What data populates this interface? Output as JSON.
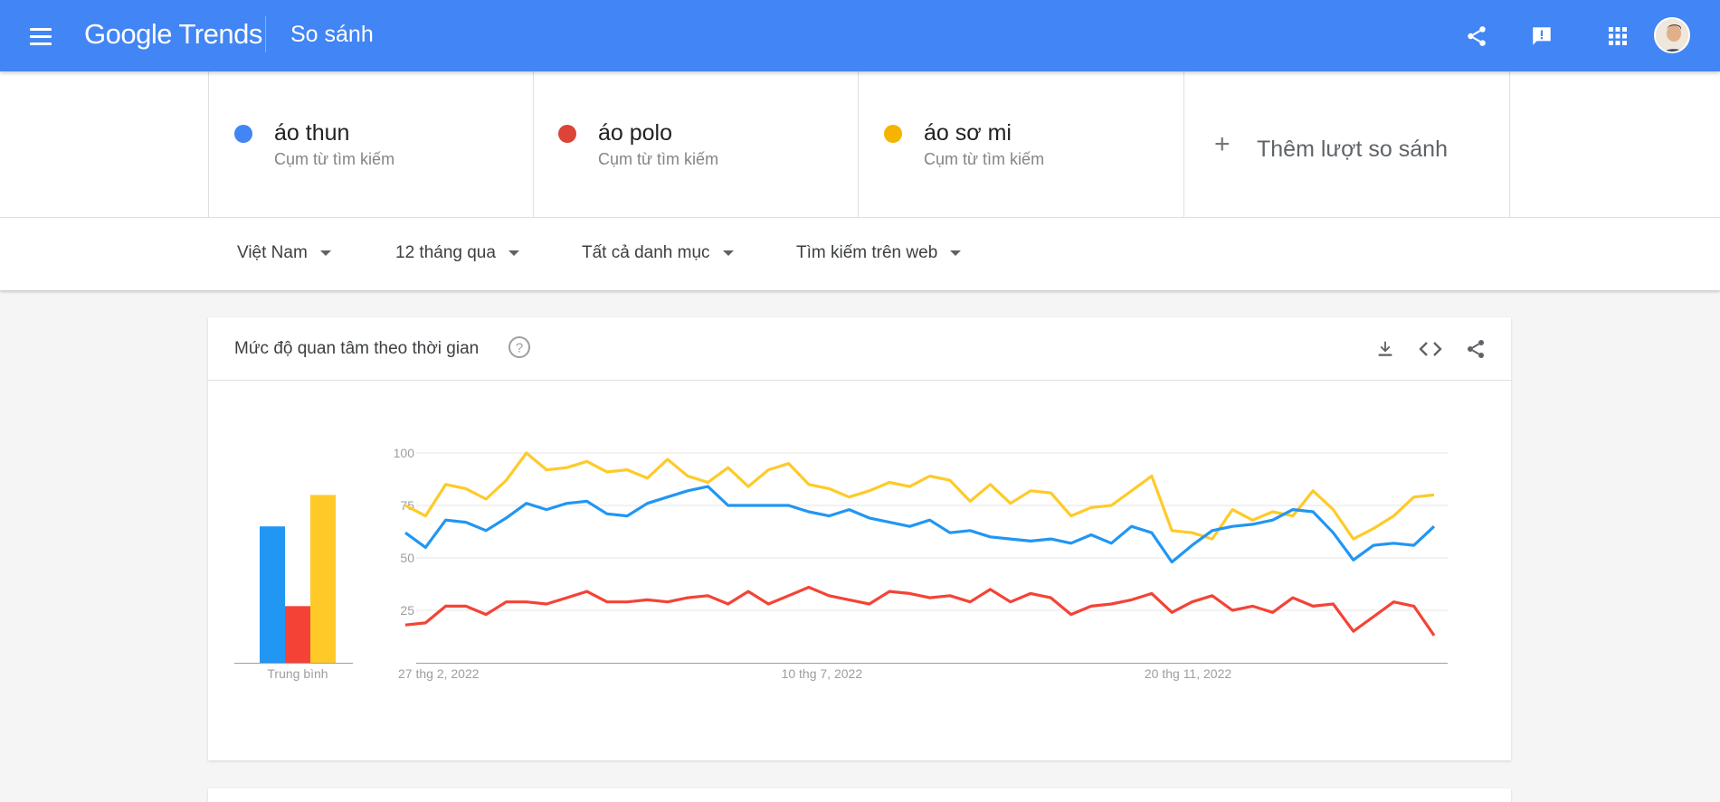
{
  "header": {
    "logo": "Google Trends",
    "title": "So sánh",
    "icons": [
      "menu-icon",
      "share-icon",
      "feedback-icon",
      "apps-icon",
      "avatar"
    ]
  },
  "terms": [
    {
      "name": "áo thun",
      "type": "Cụm từ tìm kiếm",
      "color": "#4285f4"
    },
    {
      "name": "áo polo",
      "type": "Cụm từ tìm kiếm",
      "color": "#db4437"
    },
    {
      "name": "áo sơ mi",
      "type": "Cụm từ tìm kiếm",
      "color": "#f4b400"
    }
  ],
  "add_comparison": "Thêm lượt so sánh",
  "filters": {
    "region": "Việt Nam",
    "time": "12 tháng qua",
    "category": "Tất cả danh mục",
    "search_type": "Tìm kiếm trên web"
  },
  "card": {
    "title": "Mức độ quan tâm theo thời gian",
    "icons": [
      "download-icon",
      "embed-icon",
      "share-icon"
    ]
  },
  "chart_data": [
    {
      "type": "bar",
      "categories": [
        "áo thun",
        "áo polo",
        "áo sơ mi"
      ],
      "values": [
        65,
        27,
        80
      ],
      "xlabel": "Trung bình",
      "ylim": [
        0,
        100
      ],
      "colors": [
        "#2196f3",
        "#f44336",
        "#ffca28"
      ]
    },
    {
      "type": "line",
      "x_labels": [
        "27 thg 2, 2022",
        "10 thg 7, 2022",
        "20 thg 11, 2022"
      ],
      "y_ticks": [
        25,
        50,
        75,
        100
      ],
      "ylim": [
        0,
        100
      ],
      "grid": true,
      "series": [
        {
          "name": "áo thun",
          "color": "#2196f3",
          "values": [
            62,
            55,
            68,
            67,
            63,
            69,
            76,
            73,
            76,
            77,
            71,
            70,
            76,
            79,
            82,
            84,
            75,
            75,
            75,
            75,
            72,
            70,
            73,
            69,
            67,
            65,
            68,
            62,
            63,
            60,
            59,
            58,
            59,
            57,
            61,
            57,
            65,
            62,
            48,
            56,
            63,
            65,
            66,
            68,
            73,
            72,
            62,
            49,
            56,
            57,
            56,
            65
          ]
        },
        {
          "name": "áo polo",
          "color": "#f44336",
          "values": [
            18,
            19,
            27,
            27,
            23,
            29,
            29,
            28,
            31,
            34,
            29,
            29,
            30,
            29,
            31,
            32,
            28,
            34,
            28,
            32,
            36,
            32,
            30,
            28,
            34,
            33,
            31,
            32,
            29,
            35,
            29,
            33,
            31,
            23,
            27,
            28,
            30,
            33,
            24,
            29,
            32,
            25,
            27,
            24,
            31,
            27,
            28,
            15,
            22,
            29,
            27,
            13
          ]
        },
        {
          "name": "áo sơ mi",
          "color": "#ffca28",
          "values": [
            75,
            70,
            85,
            83,
            78,
            87,
            100,
            92,
            93,
            96,
            91,
            92,
            88,
            97,
            89,
            86,
            93,
            84,
            92,
            95,
            85,
            83,
            79,
            82,
            86,
            84,
            89,
            87,
            77,
            85,
            76,
            82,
            81,
            70,
            74,
            75,
            82,
            89,
            63,
            62,
            59,
            73,
            68,
            72,
            70,
            82,
            73,
            59,
            64,
            70,
            79,
            80
          ]
        }
      ]
    }
  ]
}
